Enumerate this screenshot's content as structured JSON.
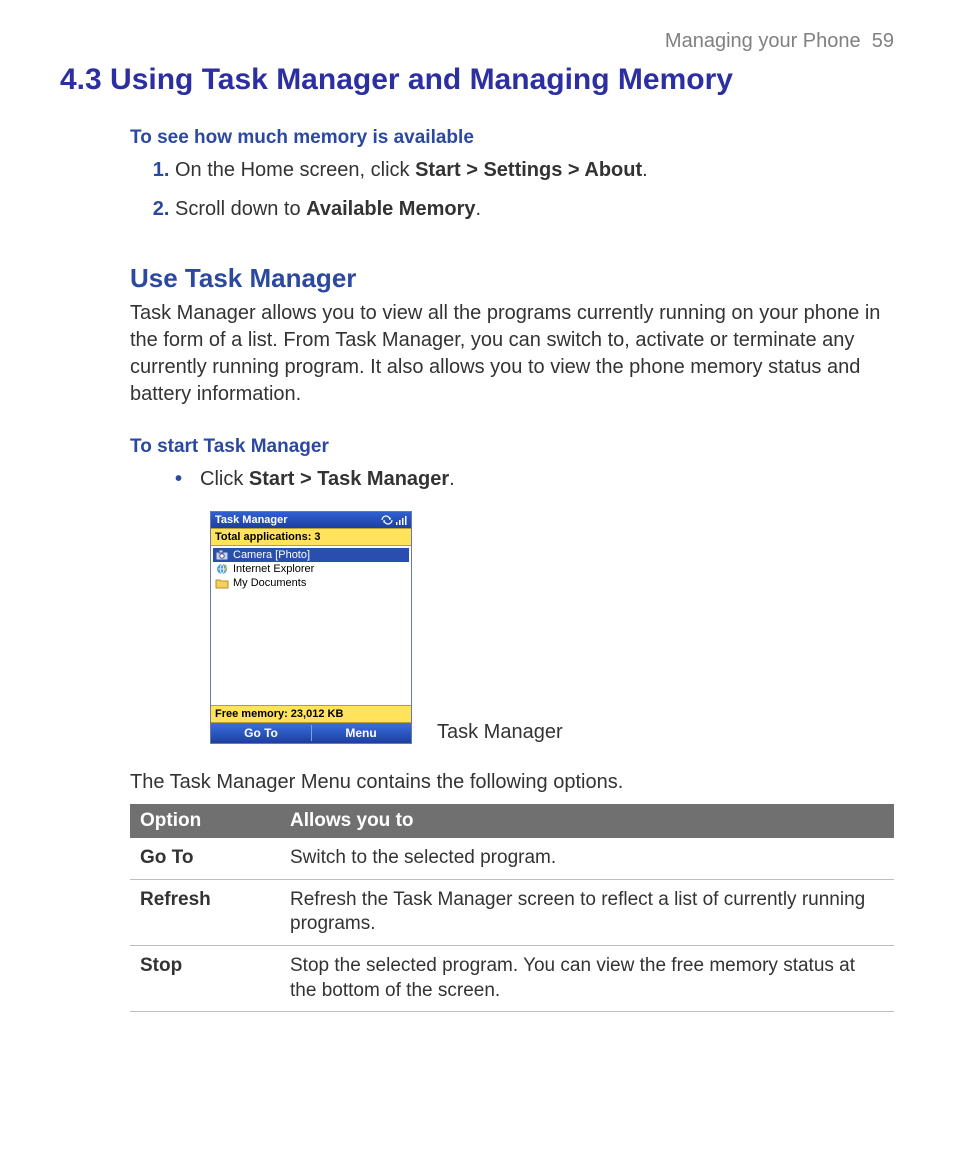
{
  "header": {
    "chapter": "Managing your Phone",
    "page": "59"
  },
  "title": "4.3 Using Task Manager and Managing Memory",
  "memory_check": {
    "heading": "To see how much memory is available",
    "step1_pre": "On the Home screen, click ",
    "step1_bold": "Start > Settings > About",
    "step1_post": ".",
    "step2_pre": "Scroll down to ",
    "step2_bold": "Available Memory",
    "step2_post": "."
  },
  "use_tm": {
    "heading": "Use Task Manager",
    "para": "Task Manager allows you to view all the programs currently running on your phone in the form of a list. From Task Manager, you can switch to, activate or terminate any currently running program. It also allows you to view the phone memory status and battery information."
  },
  "start_tm": {
    "heading": "To start Task Manager",
    "bullet_pre": "Click ",
    "bullet_bold": "Start > Task Manager",
    "bullet_post": "."
  },
  "screenshot": {
    "title": "Task Manager",
    "total_apps": "Total applications: 3",
    "apps": {
      "0": "Camera [Photo]",
      "1": "Internet Explorer",
      "2": "My Documents"
    },
    "free_mem": "Free memory: 23,012 KB",
    "sk_left": "Go To",
    "sk_right": "Menu",
    "caption": "Task Manager"
  },
  "menu_intro": "The Task Manager Menu contains the following options.",
  "table": {
    "h1": "Option",
    "h2": "Allows you to",
    "r1o": "Go To",
    "r1d": "Switch to the selected program.",
    "r2o": "Refresh",
    "r2d": "Refresh the Task Manager screen to reflect a list of currently running programs.",
    "r3o": "Stop",
    "r3d": "Stop the selected program. You can view the free memory status at the bottom of the screen."
  }
}
